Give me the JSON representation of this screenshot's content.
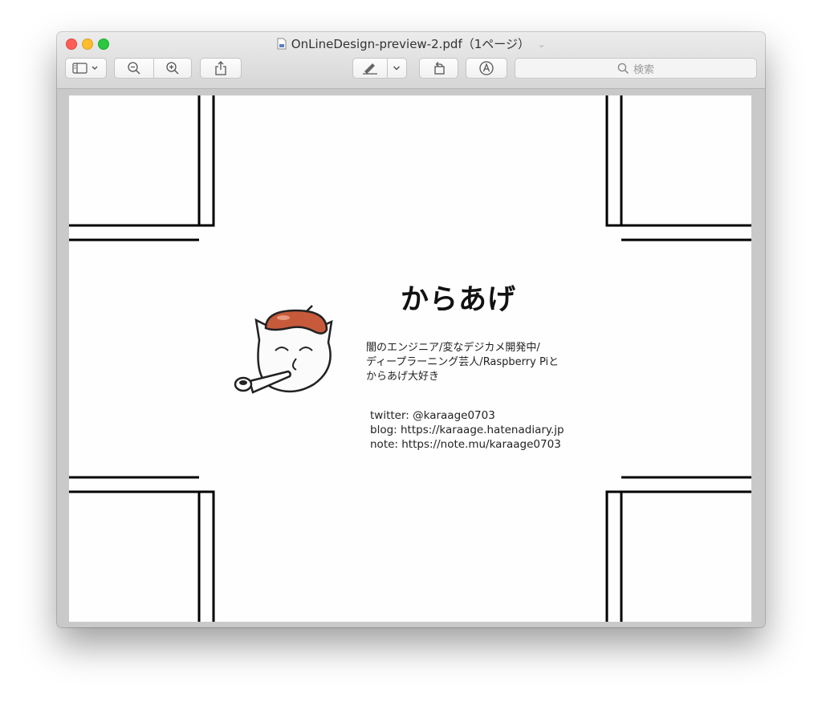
{
  "window": {
    "title": "OnLineDesign-preview-2.pdf（1ページ）"
  },
  "toolbar": {
    "sidebar_icon": "sidebar-icon",
    "zoom_out_icon": "zoom-out-icon",
    "zoom_in_icon": "zoom-in-icon",
    "share_icon": "share-icon",
    "markup_icon": "markup-pen-icon",
    "rotate_icon": "rotate-icon",
    "annotate_icon": "annotate-icon",
    "search_placeholder": "検索"
  },
  "page": {
    "name": "からあげ",
    "bio_lines": [
      "闇のエンジニア/変なデジカメ開発中/",
      "ディープラーニング芸人/Raspberry Piと",
      "からあげ大好き"
    ],
    "links": {
      "twitter": "twitter: @karaage0703",
      "blog": "blog: https://karaage.hatenadiary.jp",
      "note": "note: https://note.mu/karaage0703"
    }
  },
  "colors": {
    "traffic_red": "#fd5f57",
    "traffic_yellow": "#febc2e",
    "traffic_green": "#28c840",
    "hat": "#c65a3b"
  }
}
